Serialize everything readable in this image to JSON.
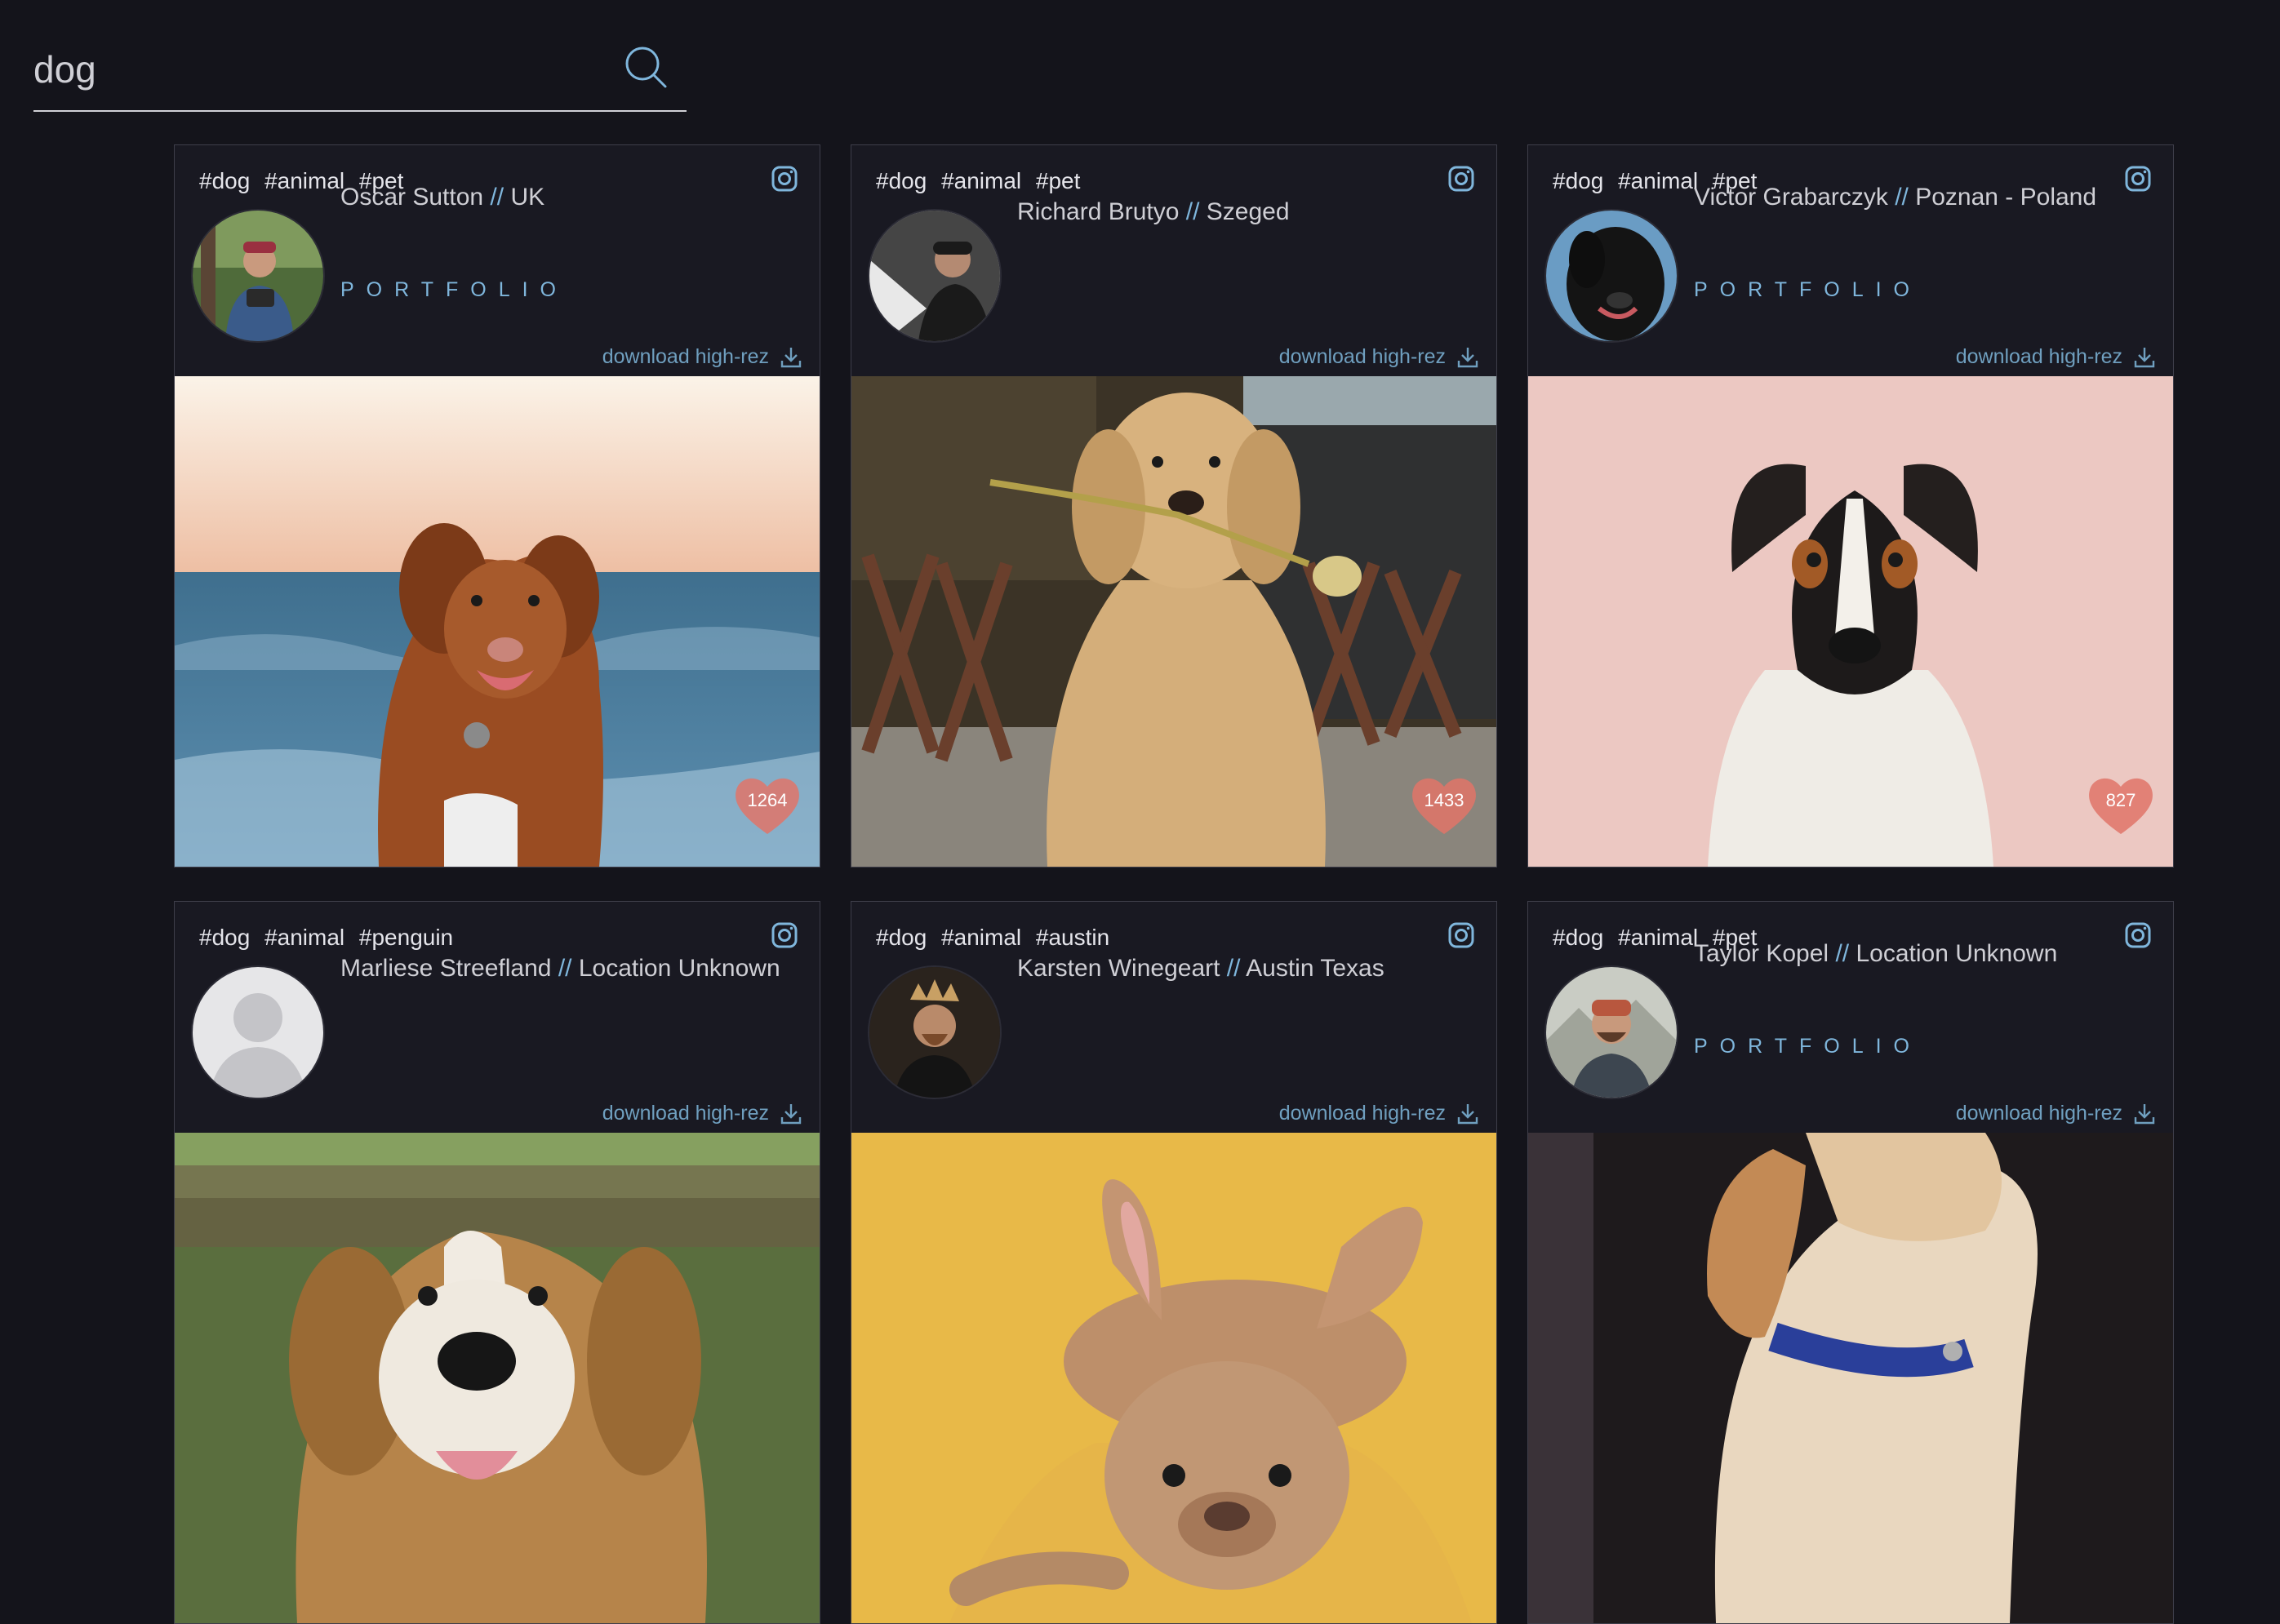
{
  "search": {
    "value": "dog",
    "icon": "search-icon"
  },
  "cards": [
    {
      "tags": "#dog #animal #pet",
      "author": "Oscar Sutton",
      "separator": "//",
      "location": "UK",
      "portfolio": "PORTFOLIO",
      "download": "download high-rez",
      "likes": "1264"
    },
    {
      "tags": "#dog #animal #pet",
      "author": "Richard Brutyo",
      "separator": "//",
      "location": "Szeged",
      "portfolio": "",
      "download": "download high-rez",
      "likes": "1433"
    },
    {
      "tags": "#dog #animal #pet",
      "author": "Victor Grabarczyk",
      "separator": "//",
      "location": "Poznan - Poland",
      "portfolio": "PORTFOLIO",
      "download": "download high-rez",
      "likes": "827"
    },
    {
      "tags": "#dog #animal #penguin",
      "author": "Marliese Streefland",
      "separator": "//",
      "location": "Location Unknown",
      "portfolio": "",
      "download": "download high-rez",
      "likes": ""
    },
    {
      "tags": "#dog #animal #austin",
      "author": "Karsten Winegeart",
      "separator": "//",
      "location": "Austin Texas",
      "portfolio": "",
      "download": "download high-rez",
      "likes": ""
    },
    {
      "tags": "#dog #animal #pet",
      "author": "Taylor Kopel",
      "separator": "//",
      "location": "Location Unknown",
      "portfolio": "PORTFOLIO",
      "download": "download high-rez",
      "likes": ""
    }
  ],
  "colors": {
    "accent": "#7fb6dc",
    "heart": "#e07468",
    "background": "#14141b",
    "card": "#191922"
  }
}
